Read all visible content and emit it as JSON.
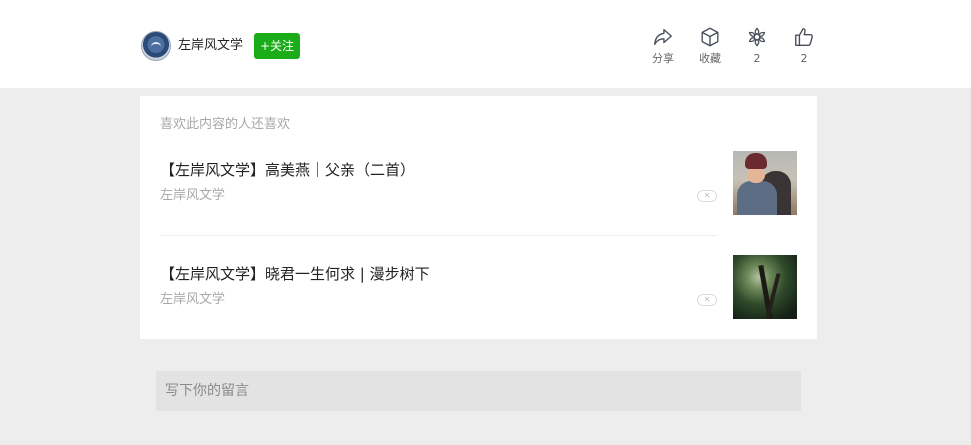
{
  "header": {
    "account_name": "左岸风文学",
    "follow_label": "+关注",
    "actions": [
      {
        "icon": "share-icon",
        "label": "分享"
      },
      {
        "icon": "favorite-box-icon",
        "label": "收藏"
      },
      {
        "icon": "wow-flower-icon",
        "label": "2"
      },
      {
        "icon": "thumbs-up-icon",
        "label": "2"
      }
    ]
  },
  "recommendations": {
    "heading": "喜欢此内容的人还喜欢",
    "items": [
      {
        "title": "【左岸风文学】高美燕｜父亲（二首）",
        "source": "左岸风文学",
        "dislike": "✕"
      },
      {
        "title": "【左岸风文学】晓君一生何求 | 漫步树下",
        "source": "左岸风文学",
        "dislike": "✕"
      }
    ]
  },
  "comment": {
    "placeholder": "写下你的留言"
  }
}
